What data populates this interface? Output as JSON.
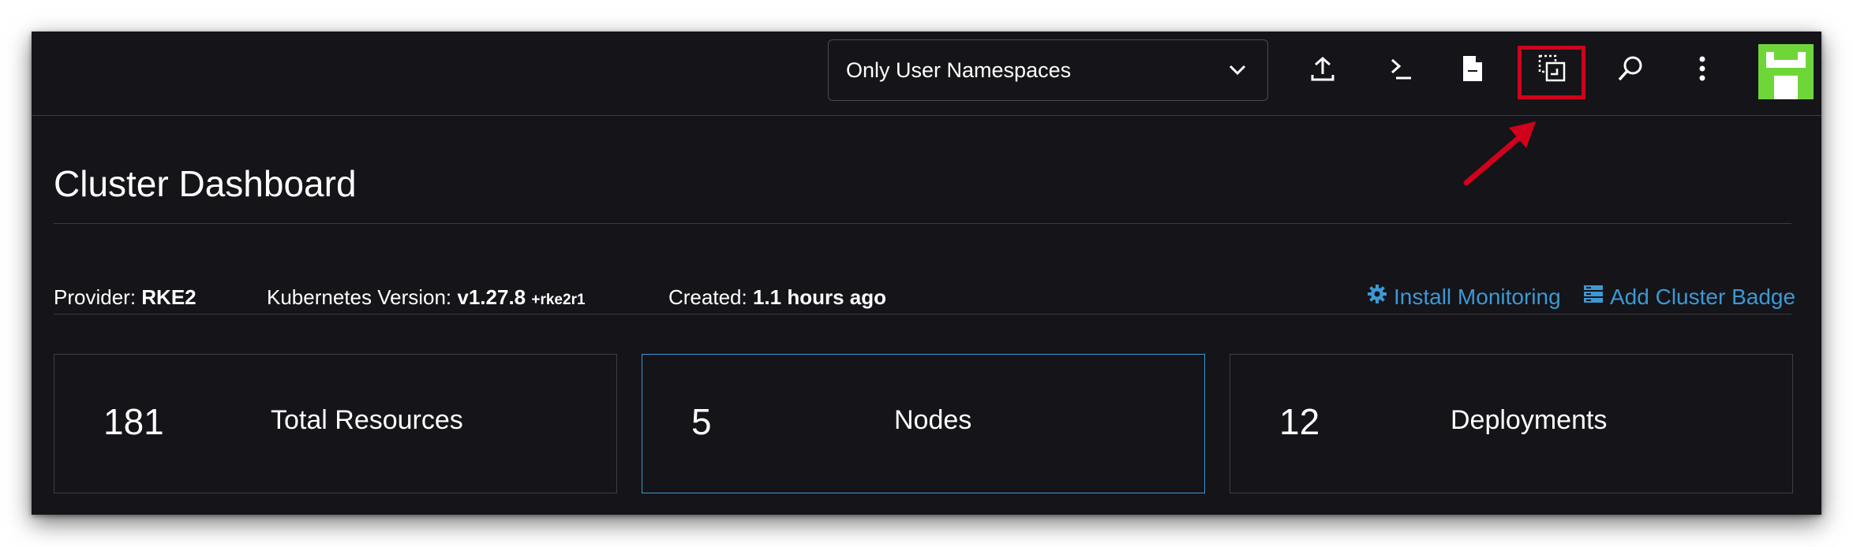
{
  "header": {
    "namespace_filter": {
      "value": "Only User Namespaces",
      "icon": "chevron-down-icon"
    },
    "tools": [
      {
        "name": "import-yaml-icon"
      },
      {
        "name": "kubectl-shell-icon"
      },
      {
        "name": "download-kubeconfig-icon"
      },
      {
        "name": "copy-kubeconfig-icon",
        "highlighted": true
      },
      {
        "name": "search-icon"
      },
      {
        "name": "more-vertical-icon"
      }
    ],
    "accent_colors": {
      "highlight": "#d0011b",
      "avatar": "#6fd63a",
      "link": "#3d98d3"
    }
  },
  "page": {
    "title": "Cluster Dashboard",
    "provider_label": "Provider:",
    "provider_value": "RKE2",
    "k8s_label": "Kubernetes Version:",
    "k8s_value": "v1.27.8",
    "k8s_suffix": "+rke2r1",
    "created_label": "Created:",
    "created_value": "1.1 hours ago",
    "install_monitoring": "Install Monitoring",
    "add_cluster_badge": "Add Cluster Badge"
  },
  "cards": [
    {
      "count": "181",
      "label": "Total Resources"
    },
    {
      "count": "5",
      "label": "Nodes"
    },
    {
      "count": "12",
      "label": "Deployments"
    }
  ]
}
